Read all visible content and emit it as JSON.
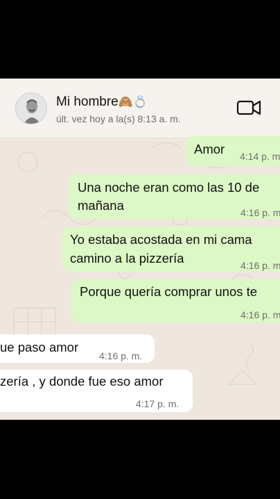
{
  "contact": {
    "name": "Mi hombre",
    "name_emoji": "🙈💍",
    "last_seen": "últ. vez hoy a la(s) 8:13 a. m."
  },
  "messages": [
    {
      "direction": "out",
      "lines": [
        "Amor"
      ],
      "time": "4:14 p. m"
    },
    {
      "direction": "out",
      "lines": [
        "Una noche eran como las 10 de",
        "mañana"
      ],
      "time": "4:16 p. m"
    },
    {
      "direction": "out",
      "lines": [
        "Yo estaba acostada en mi cama",
        "camino a la pizzería"
      ],
      "time": "4:16 p. m"
    },
    {
      "direction": "out",
      "lines": [
        "Porque quería comprar unos te"
      ],
      "time": "4:16 p. m"
    },
    {
      "direction": "in",
      "lines": [
        "ue paso amor"
      ],
      "time": "4:16 p. m."
    },
    {
      "direction": "in",
      "lines": [
        "zería , y donde fue eso amor"
      ],
      "time": "4:17 p. m."
    }
  ],
  "colors": {
    "outgoing_bubble": "#dcf8c6",
    "incoming_bubble": "#ffffff",
    "chat_background": "#efe7de"
  }
}
